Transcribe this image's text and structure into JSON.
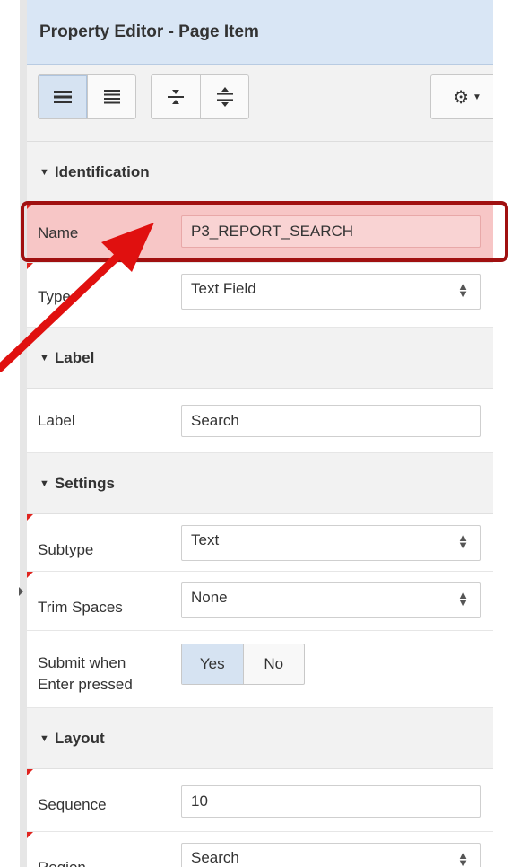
{
  "header": {
    "title": "Property Editor - Page Item"
  },
  "toolbar": {
    "buttons": [
      "show-common-icon",
      "show-all-icon",
      "collapse-all-icon",
      "expand-all-icon"
    ],
    "gear_icon": "gear-icon"
  },
  "sections": {
    "identification": {
      "title": "Identification"
    },
    "label": {
      "title": "Label"
    },
    "settings": {
      "title": "Settings"
    },
    "layout": {
      "title": "Layout"
    }
  },
  "fields": {
    "name": {
      "label": "Name",
      "value": "P3_REPORT_SEARCH"
    },
    "type": {
      "label": "Type",
      "value": "Text Field"
    },
    "label": {
      "label": "Label",
      "value": "Search"
    },
    "subtype": {
      "label": "Subtype",
      "value": "Text"
    },
    "trim": {
      "label": "Trim Spaces",
      "value": "None"
    },
    "submit": {
      "label_line1": "Submit when",
      "label_line2": "Enter pressed",
      "yes": "Yes",
      "no": "No",
      "selected": "Yes"
    },
    "sequence": {
      "label": "Sequence",
      "value": "10"
    },
    "region": {
      "label": "Region",
      "value": "Search"
    }
  },
  "colors": {
    "accent": "#d9e6f5",
    "annotation": "#e0100f",
    "highlight": "#f7c6c6"
  }
}
